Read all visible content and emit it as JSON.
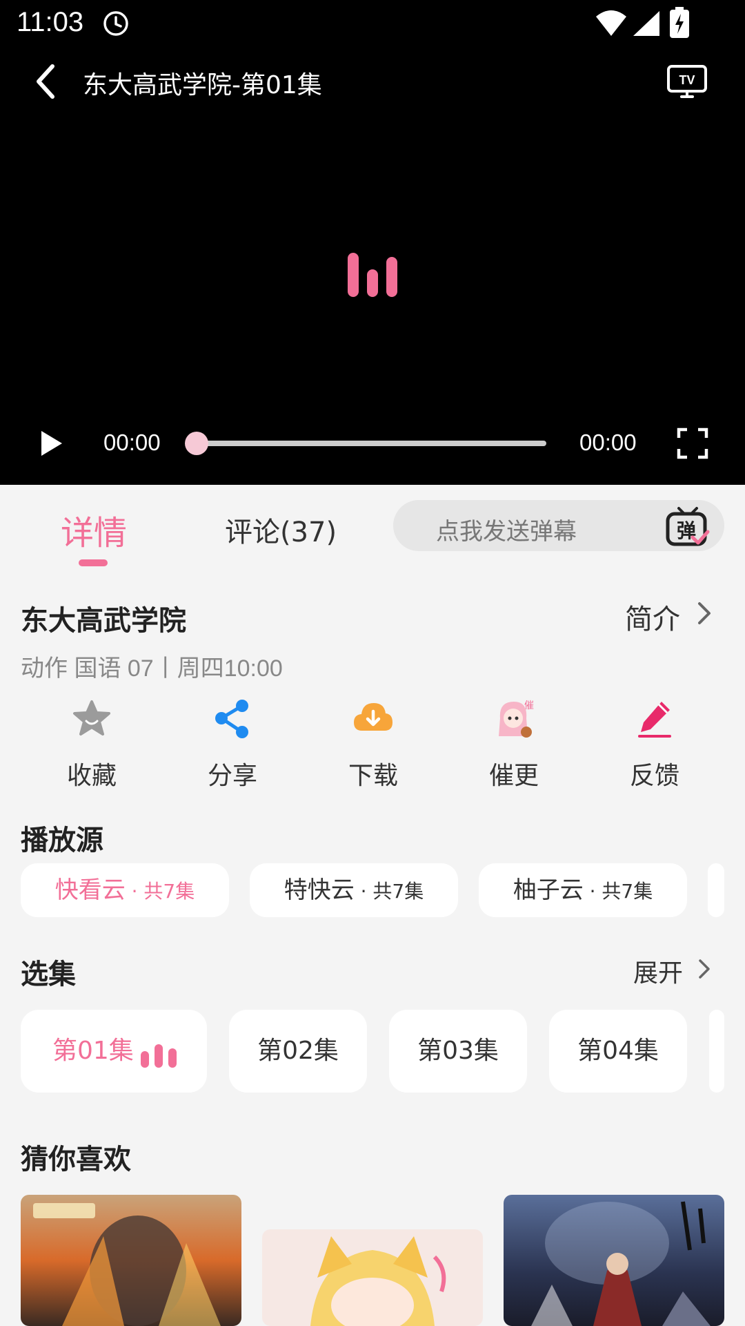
{
  "status_bar": {
    "time": "11:03"
  },
  "player": {
    "title": "东大高武学院-第01集",
    "current_time": "00:00",
    "total_time": "00:00",
    "progress": 0
  },
  "tabs": {
    "details": "详情",
    "comments": "评论(37)",
    "danmaku_placeholder": "点我发送弹幕",
    "danmaku_icon_char": "弹"
  },
  "show": {
    "title": "东大高武学院",
    "intro_label": "简介",
    "meta": "动作 国语 07丨周四10:00"
  },
  "actions": [
    {
      "label": "收藏",
      "icon": "star-icon"
    },
    {
      "label": "分享",
      "icon": "share-icon"
    },
    {
      "label": "下载",
      "icon": "cloud-download-icon"
    },
    {
      "label": "催更",
      "icon": "anime-girl-urge-icon",
      "icon_char": "催"
    },
    {
      "label": "反馈",
      "icon": "pencil-icon"
    }
  ],
  "sources": {
    "title": "播放源",
    "items": [
      {
        "name": "快看云",
        "count": " · 共7集",
        "active": true
      },
      {
        "name": "特快云",
        "count": " · 共7集",
        "active": false
      },
      {
        "name": "柚子云",
        "count": " · 共7集",
        "active": false
      }
    ]
  },
  "episodes": {
    "title": "选集",
    "expand_label": "展开",
    "items": [
      {
        "label": "第01集",
        "active": true
      },
      {
        "label": "第02集",
        "active": false
      },
      {
        "label": "第03集",
        "active": false
      },
      {
        "label": "第04集",
        "active": false
      }
    ]
  },
  "recommend": {
    "title": "猜你喜欢"
  },
  "colors": {
    "accent": "#f26f97",
    "share_blue": "#1f8bf0",
    "download_orange": "#f7a53a",
    "feedback_pink": "#e82a6a"
  }
}
